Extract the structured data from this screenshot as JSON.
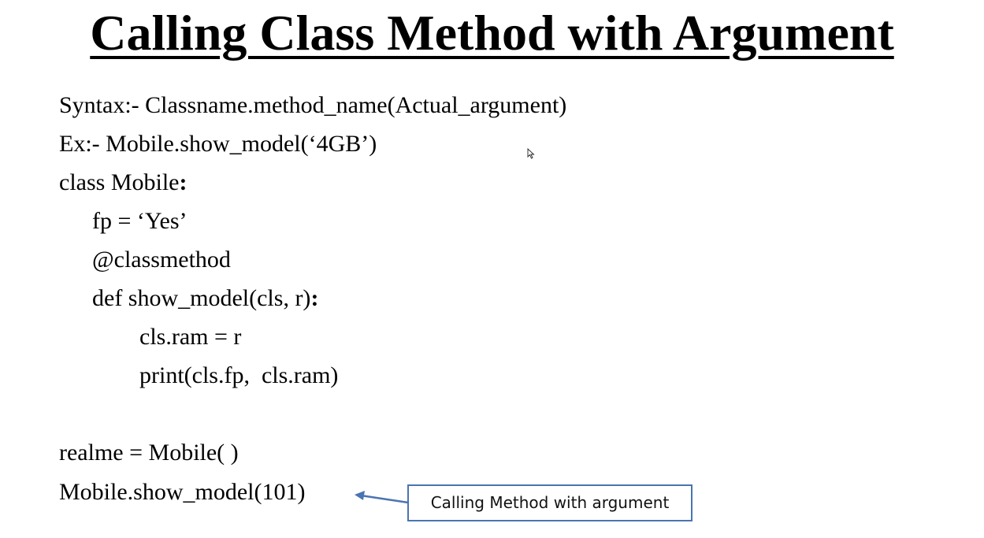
{
  "title": "Calling Class Method with Argument",
  "lines": {
    "syntax": "Syntax:- Classname.method_name(Actual_argument)",
    "example": "Ex:- Mobile.show_model(‘4GB’)",
    "class_decl_text": "class Mobile",
    "class_decl_colon": ":",
    "fp": "fp = ‘Yes’",
    "decorator": "@classmethod",
    "def_text": "def show_model(cls, r)",
    "def_colon": ":",
    "assign": "cls.ram = r",
    "print_stmt": "print(cls.fp,  cls.ram)",
    "instance": "realme = Mobile( )",
    "call": "Mobile.show_model(101)"
  },
  "callout": {
    "label": "Calling Method with argument",
    "border_color": "#4a74b2"
  },
  "icons": {
    "arrow": "arrow-left-icon",
    "cursor": "mouse-pointer-icon"
  }
}
